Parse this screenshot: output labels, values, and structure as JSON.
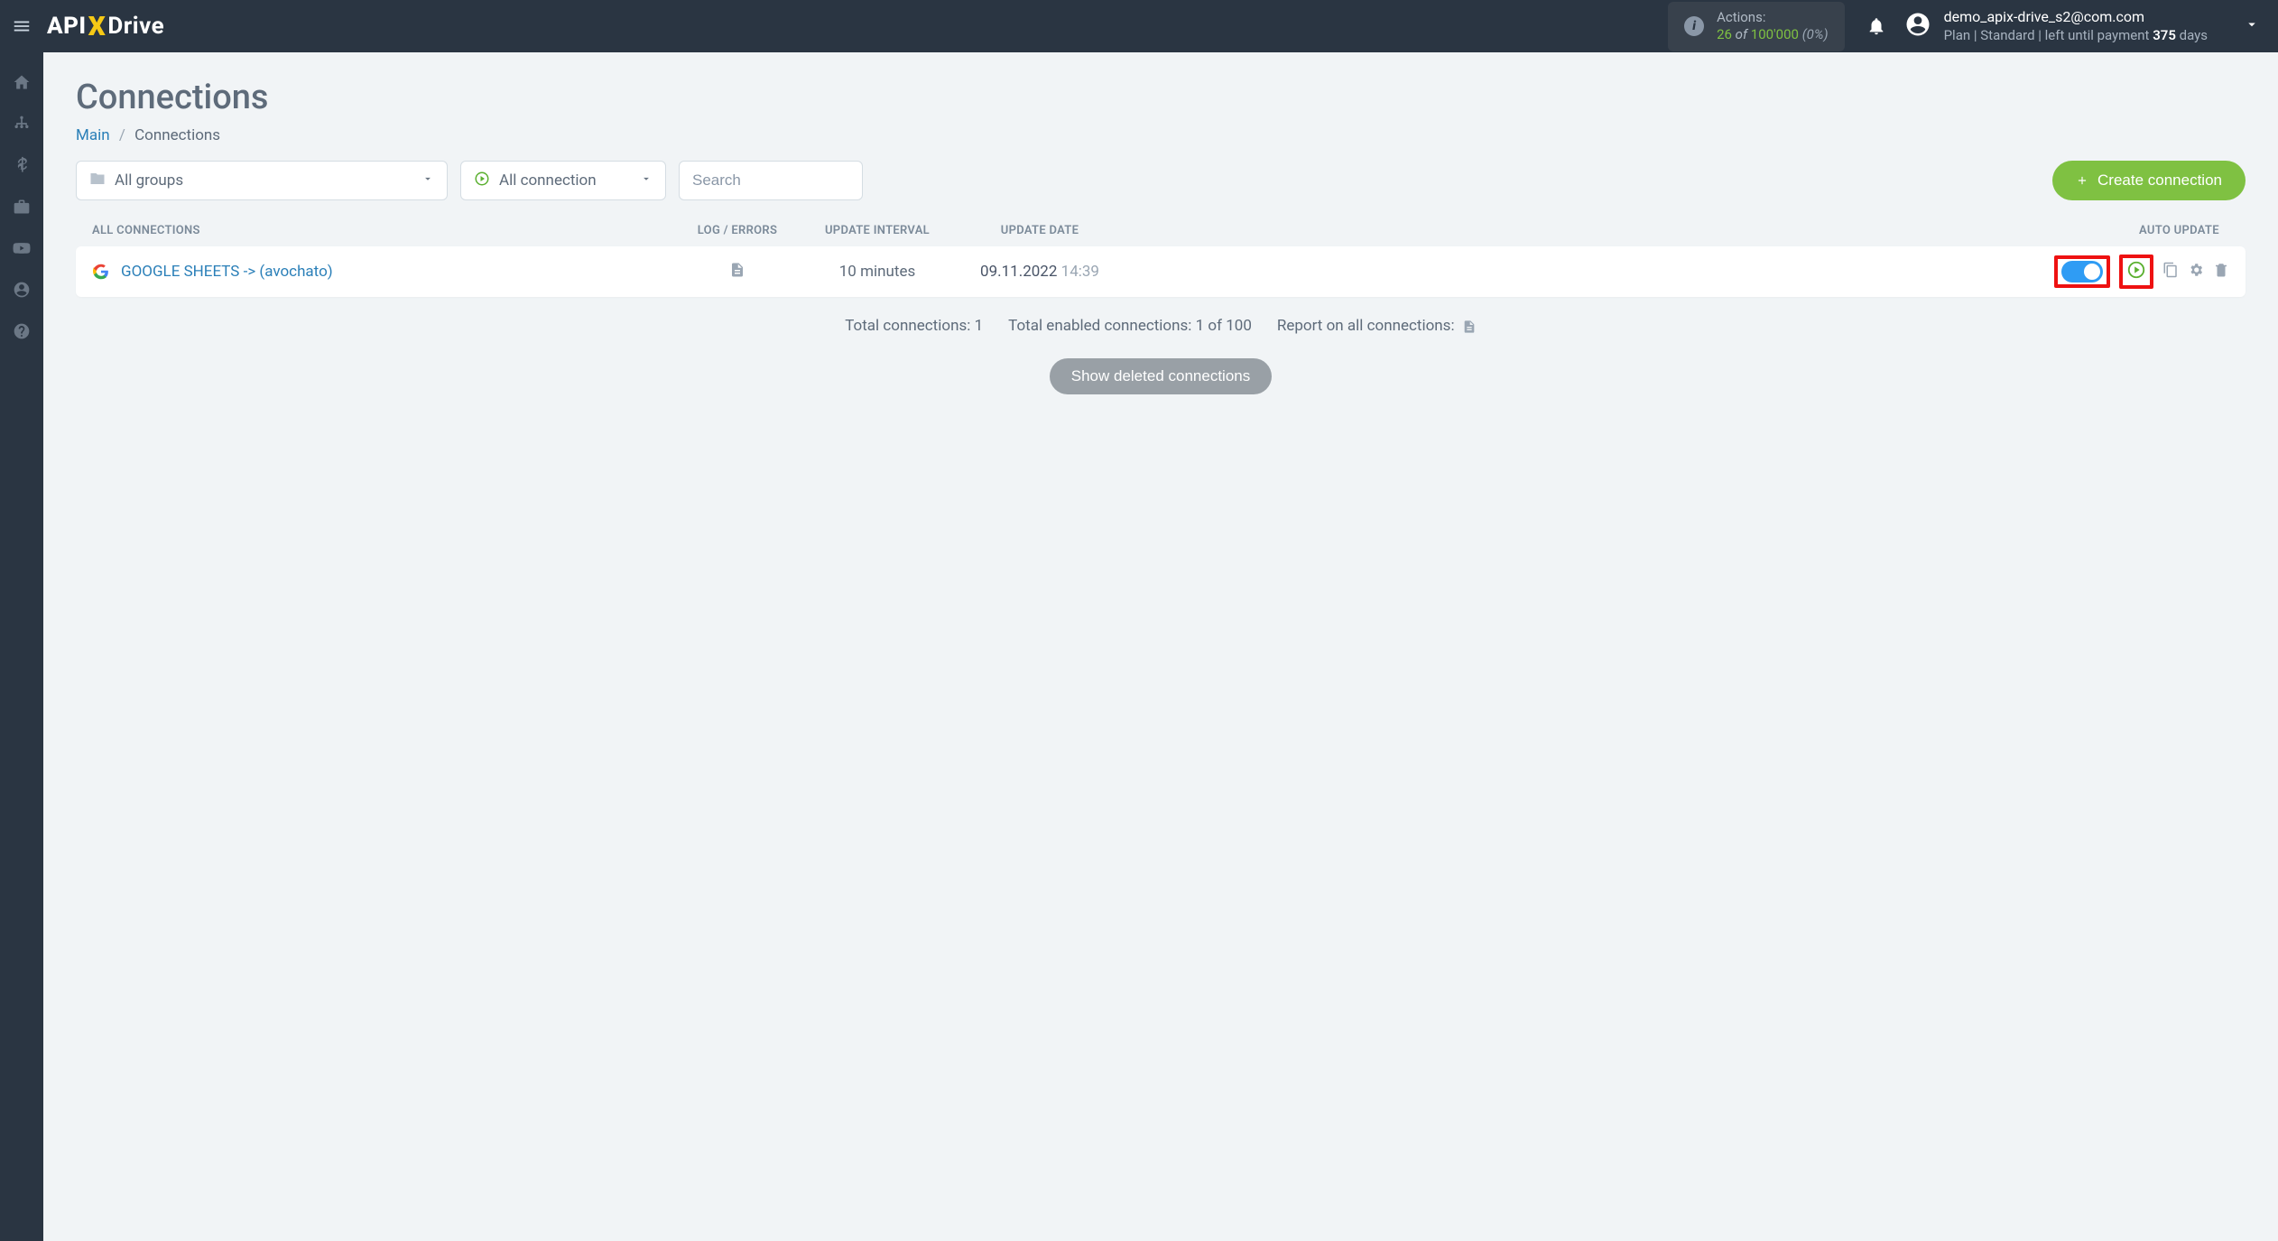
{
  "header": {
    "actions": {
      "label": "Actions:",
      "used": "26",
      "of": "of",
      "total": "100'000",
      "pct": "(0%)"
    },
    "user": {
      "email": "demo_apix-drive_s2@com.com",
      "plan_prefix": "Plan |",
      "plan_name": "Standard",
      "plan_mid": "| left until payment",
      "days": "375",
      "days_suffix": "days"
    }
  },
  "page": {
    "title": "Connections",
    "breadcrumb": {
      "main": "Main",
      "current": "Connections"
    }
  },
  "filters": {
    "groups": "All groups",
    "status": "All connection",
    "search_placeholder": "Search",
    "create_btn": "Create connection"
  },
  "table": {
    "headers": {
      "all": "ALL CONNECTIONS",
      "log": "LOG / ERRORS",
      "interval": "UPDATE INTERVAL",
      "date": "UPDATE DATE",
      "auto": "AUTO UPDATE"
    },
    "rows": [
      {
        "name": "GOOGLE SHEETS -> (avochato)",
        "interval": "10 minutes",
        "date": "09.11.2022",
        "time": "14:39"
      }
    ]
  },
  "stats": {
    "total": "Total connections: 1",
    "enabled": "Total enabled connections: 1 of 100",
    "report": "Report on all connections:"
  },
  "buttons": {
    "show_deleted": "Show deleted connections"
  }
}
